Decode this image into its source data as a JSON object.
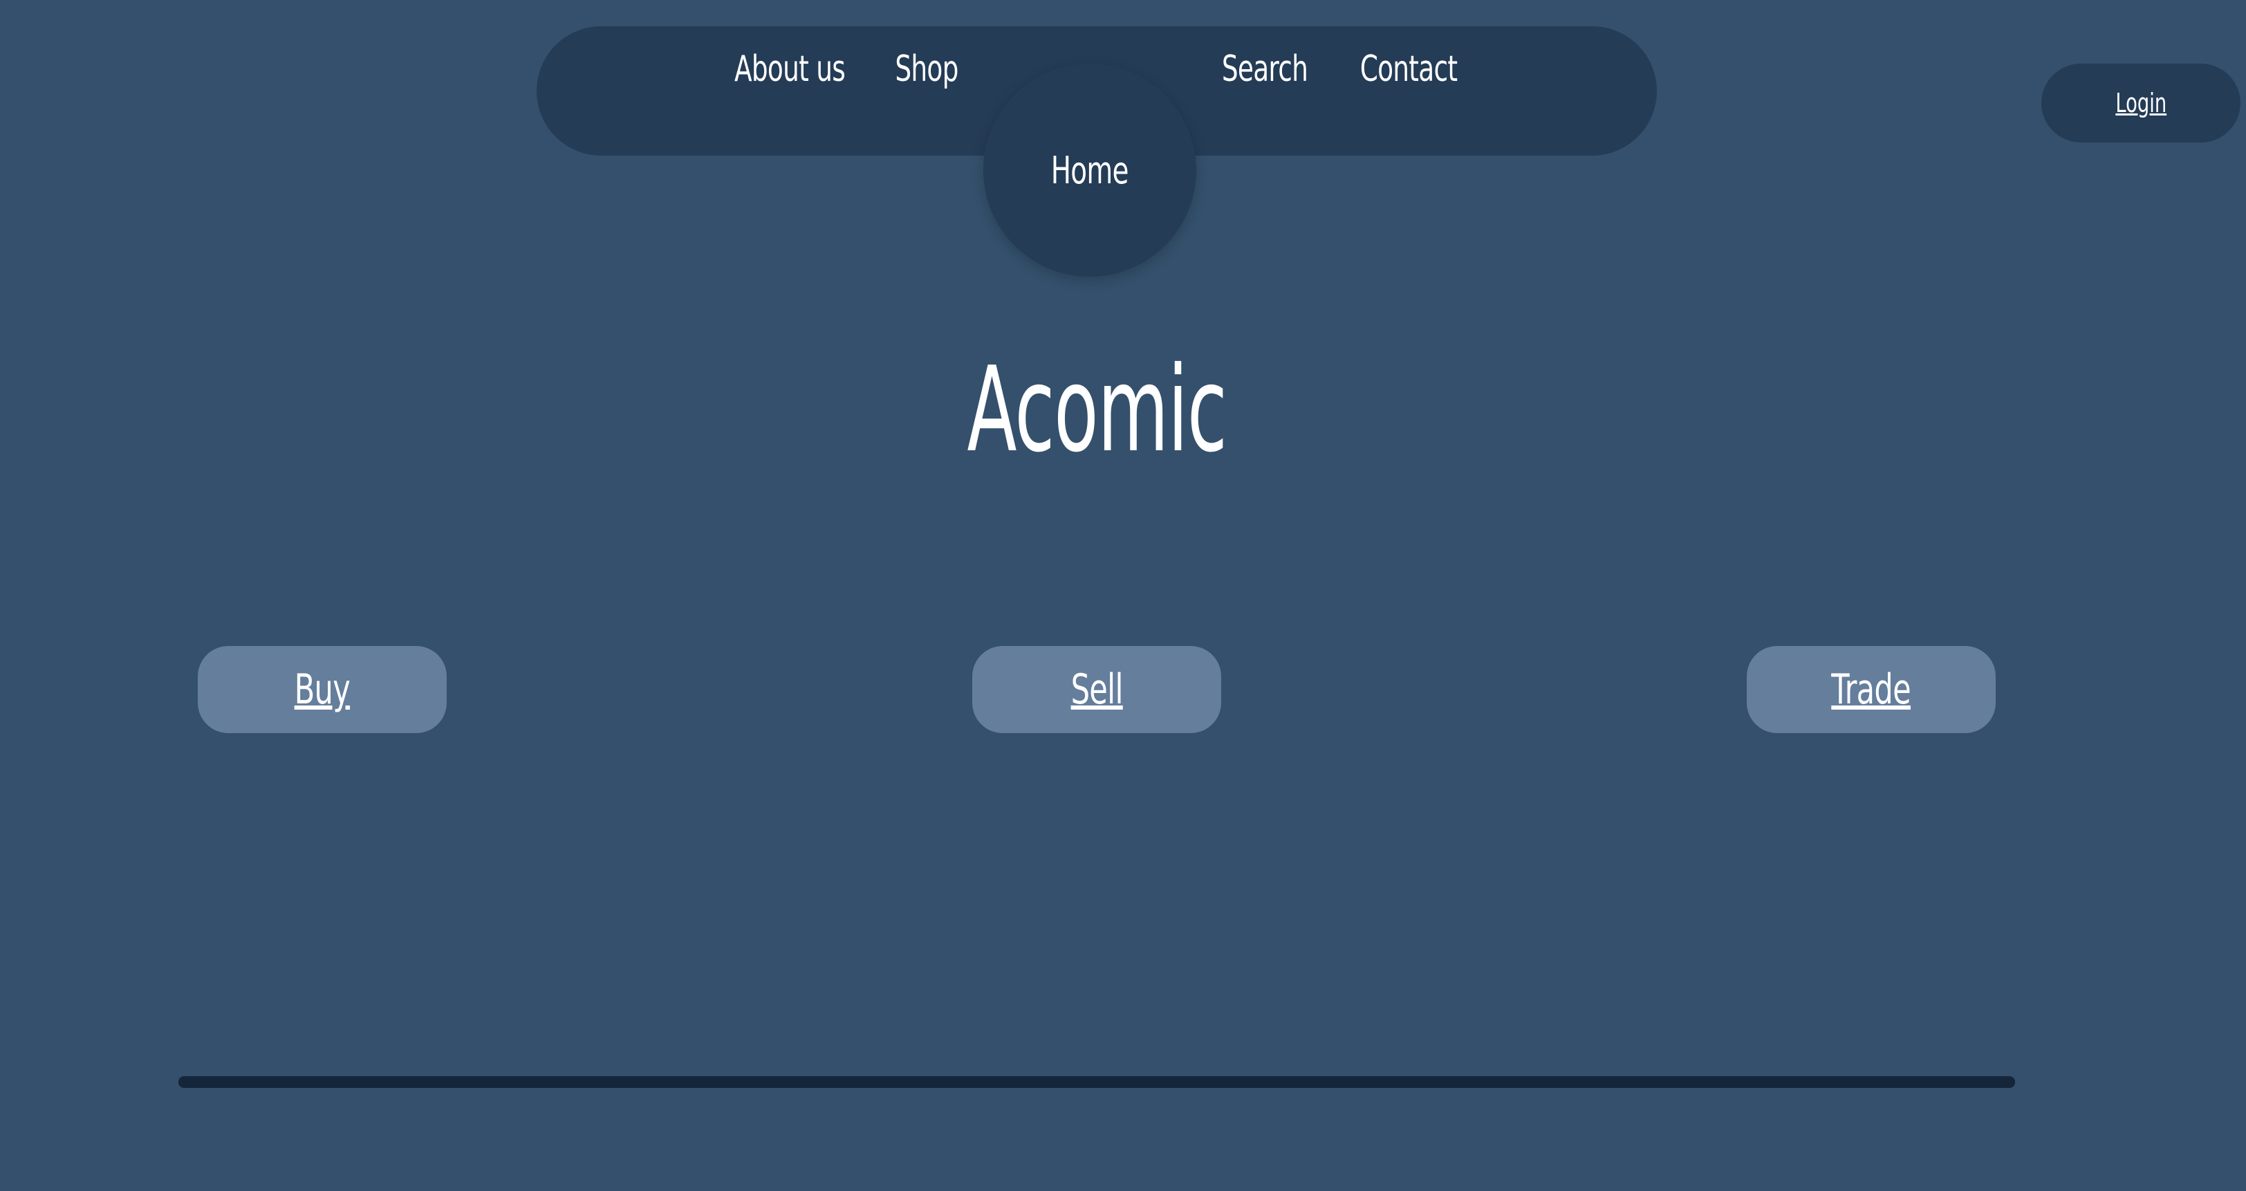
{
  "nav": {
    "items": [
      {
        "label": "About us"
      },
      {
        "label": "Shop"
      },
      {
        "label": "Search"
      },
      {
        "label": "Contact"
      }
    ],
    "home_label": "Home"
  },
  "header": {
    "login_label": "Login"
  },
  "main": {
    "title": "Acomic",
    "actions": [
      {
        "label": "Buy"
      },
      {
        "label": "Sell"
      },
      {
        "label": "Trade"
      }
    ]
  },
  "colors": {
    "background": "#34506c",
    "nav_background": "#243c56",
    "action_button": "#647e9c",
    "divider": "#15263a",
    "text": "#ffffff"
  }
}
